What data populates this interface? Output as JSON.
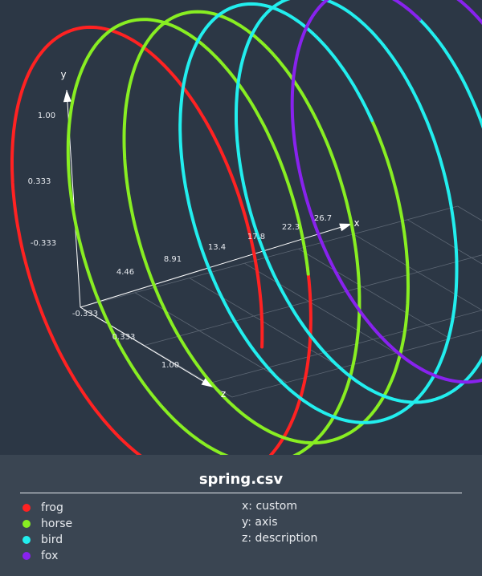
{
  "chart_data": {
    "type": "line3d",
    "title": "spring.csv",
    "axes": {
      "x": {
        "label": "x",
        "description": "custom",
        "ticks": [
          "4.46",
          "8.91",
          "13.4",
          "17.8",
          "22.3",
          "26.7"
        ]
      },
      "y": {
        "label": "y",
        "description": "axis",
        "ticks": [
          "-0.333",
          "0.333",
          "1.00"
        ]
      },
      "z": {
        "label": "z",
        "description": "description",
        "ticks": [
          "-0.333",
          "0.333",
          "1.00"
        ]
      }
    },
    "series": [
      {
        "name": "frog",
        "color": "#ff2222",
        "x_range": [
          0,
          4.46
        ]
      },
      {
        "name": "horse",
        "color": "#88ee22",
        "x_range": [
          4.46,
          13.4
        ]
      },
      {
        "name": "bird",
        "color": "#22eeee",
        "x_range": [
          13.4,
          22.3
        ]
      },
      {
        "name": "fox",
        "color": "#8822ee",
        "x_range": [
          22.3,
          26.7
        ]
      }
    ]
  },
  "footer": {
    "title": "spring.csv",
    "axis_desc": [
      {
        "axis": "x",
        "text": "custom"
      },
      {
        "axis": "y",
        "text": "axis"
      },
      {
        "axis": "z",
        "text": "description"
      }
    ]
  }
}
